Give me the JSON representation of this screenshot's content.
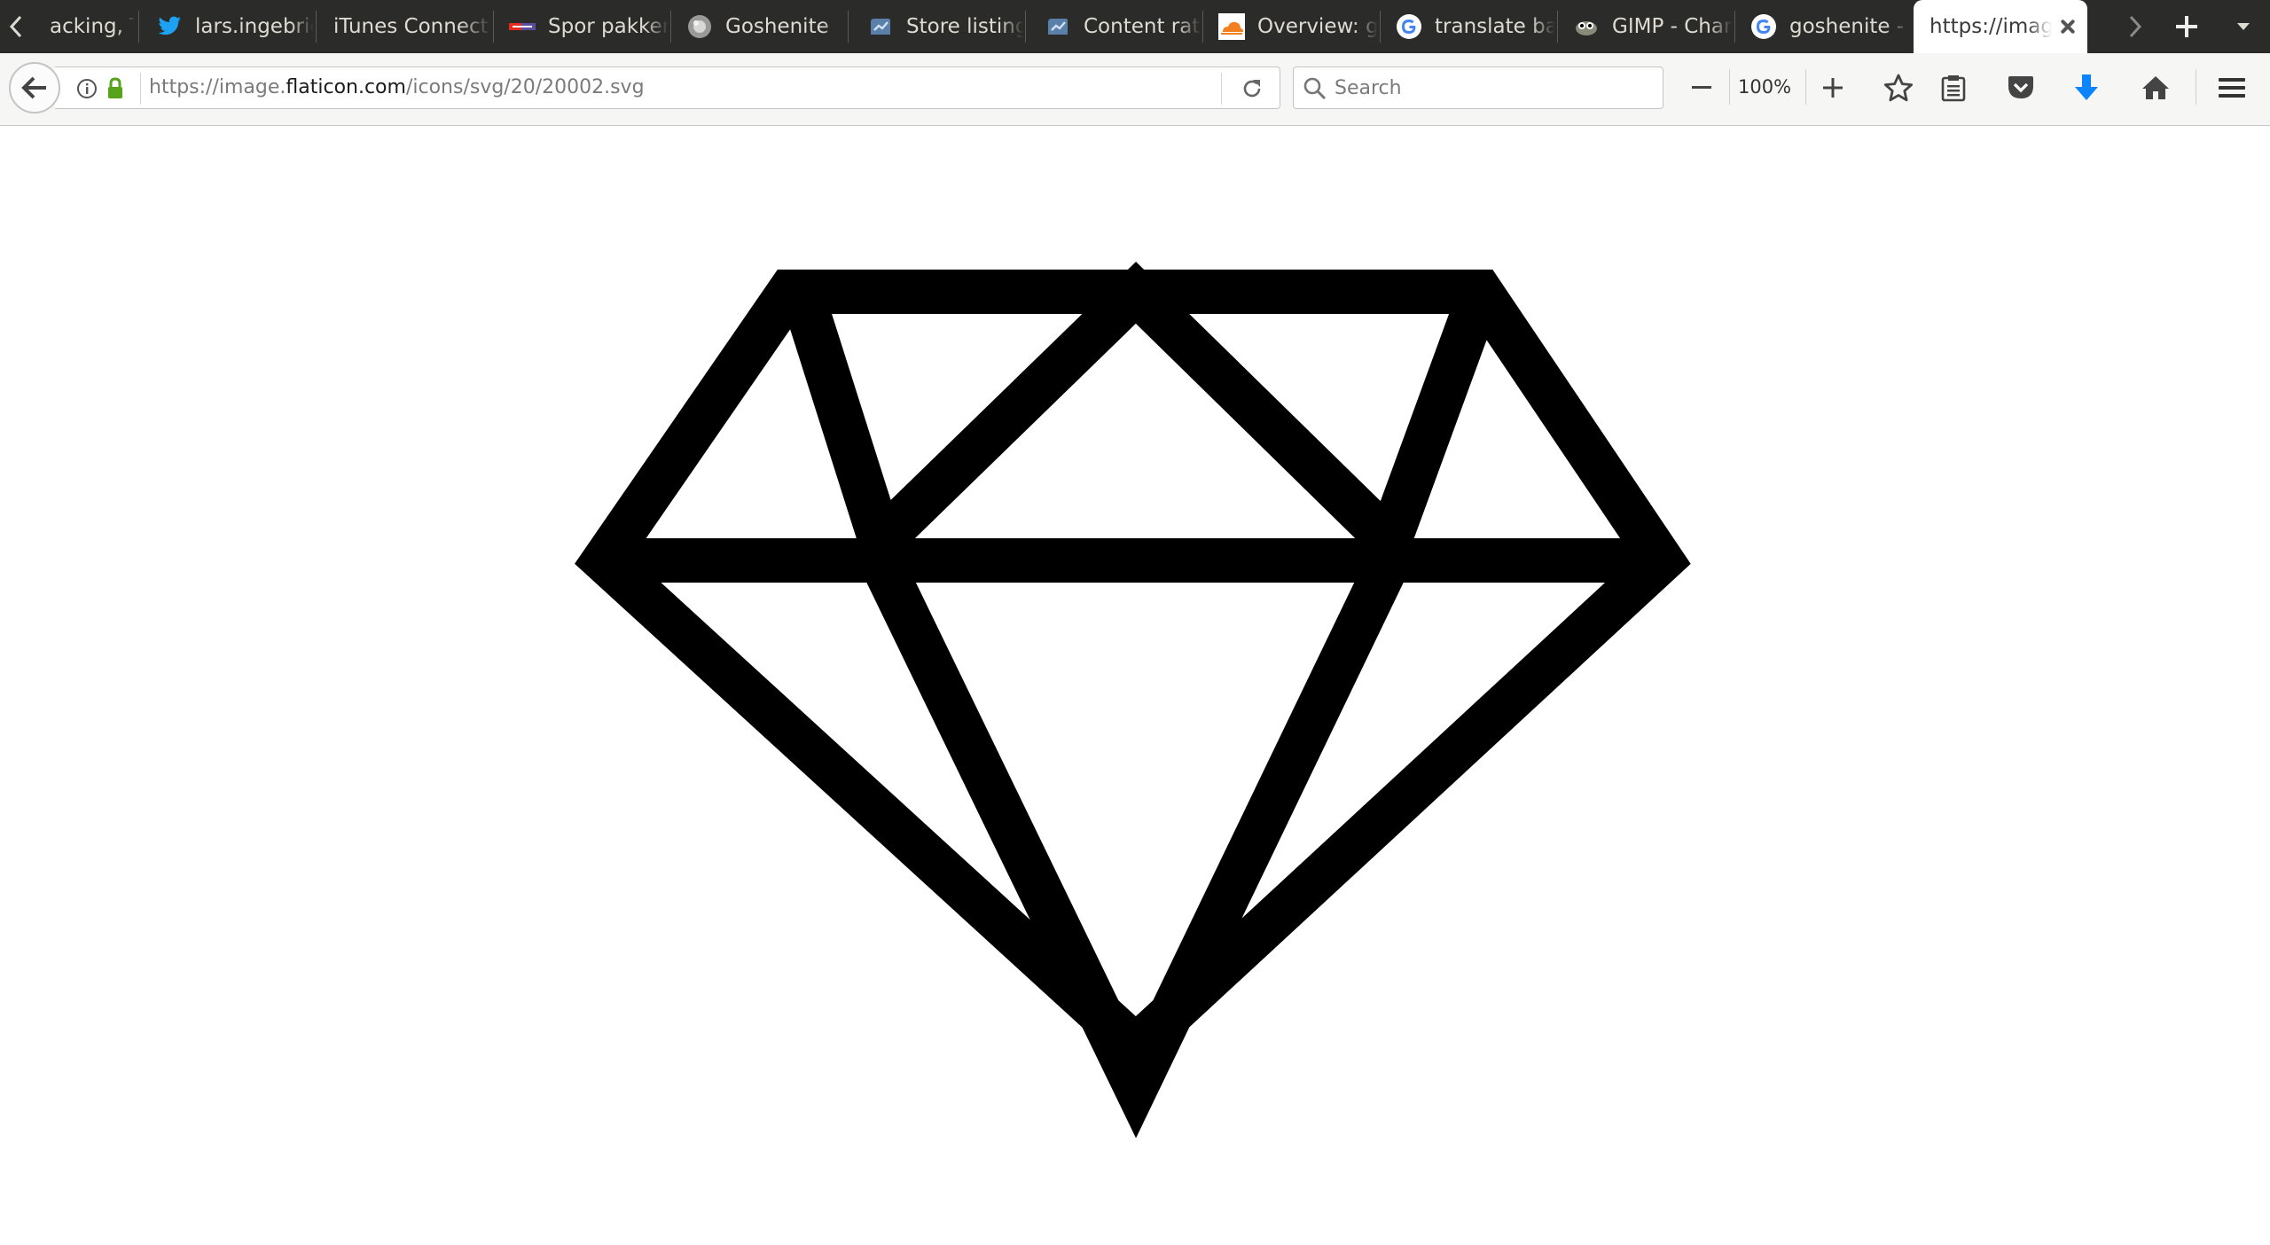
{
  "tabs": [
    {
      "label": "acking, Tra",
      "icon": "none"
    },
    {
      "label": "lars.ingebrig",
      "icon": "twitter-icon"
    },
    {
      "label": "iTunes Connect",
      "icon": "none"
    },
    {
      "label": "Spor pakken",
      "icon": "posten-icon"
    },
    {
      "label": "Goshenite",
      "icon": "gem-photo-icon"
    },
    {
      "label": "Store listing",
      "icon": "google-play-console-icon"
    },
    {
      "label": "Content rat",
      "icon": "google-play-console-icon"
    },
    {
      "label": "Overview: g",
      "icon": "cloudflare-icon"
    },
    {
      "label": "translate ba",
      "icon": "google-icon"
    },
    {
      "label": "GIMP - Chan",
      "icon": "gimp-icon"
    },
    {
      "label": "goshenite -",
      "icon": "google-icon"
    },
    {
      "label": "https://image",
      "icon": "none",
      "active": true
    }
  ],
  "url": {
    "prefix": "https://image.",
    "host": "flaticon.com",
    "path": "/icons/svg/20/20002.svg"
  },
  "search": {
    "placeholder": "Search"
  },
  "zoom": "100%",
  "colors": {
    "tabstrip": "#2b2b29",
    "toolbar": "#f6f6f5",
    "secure_lock": "#57a21b",
    "download_arrow": "#0a84ff",
    "diamond": "#000000"
  },
  "content": {
    "image_subject": "diamond-outline-icon"
  }
}
